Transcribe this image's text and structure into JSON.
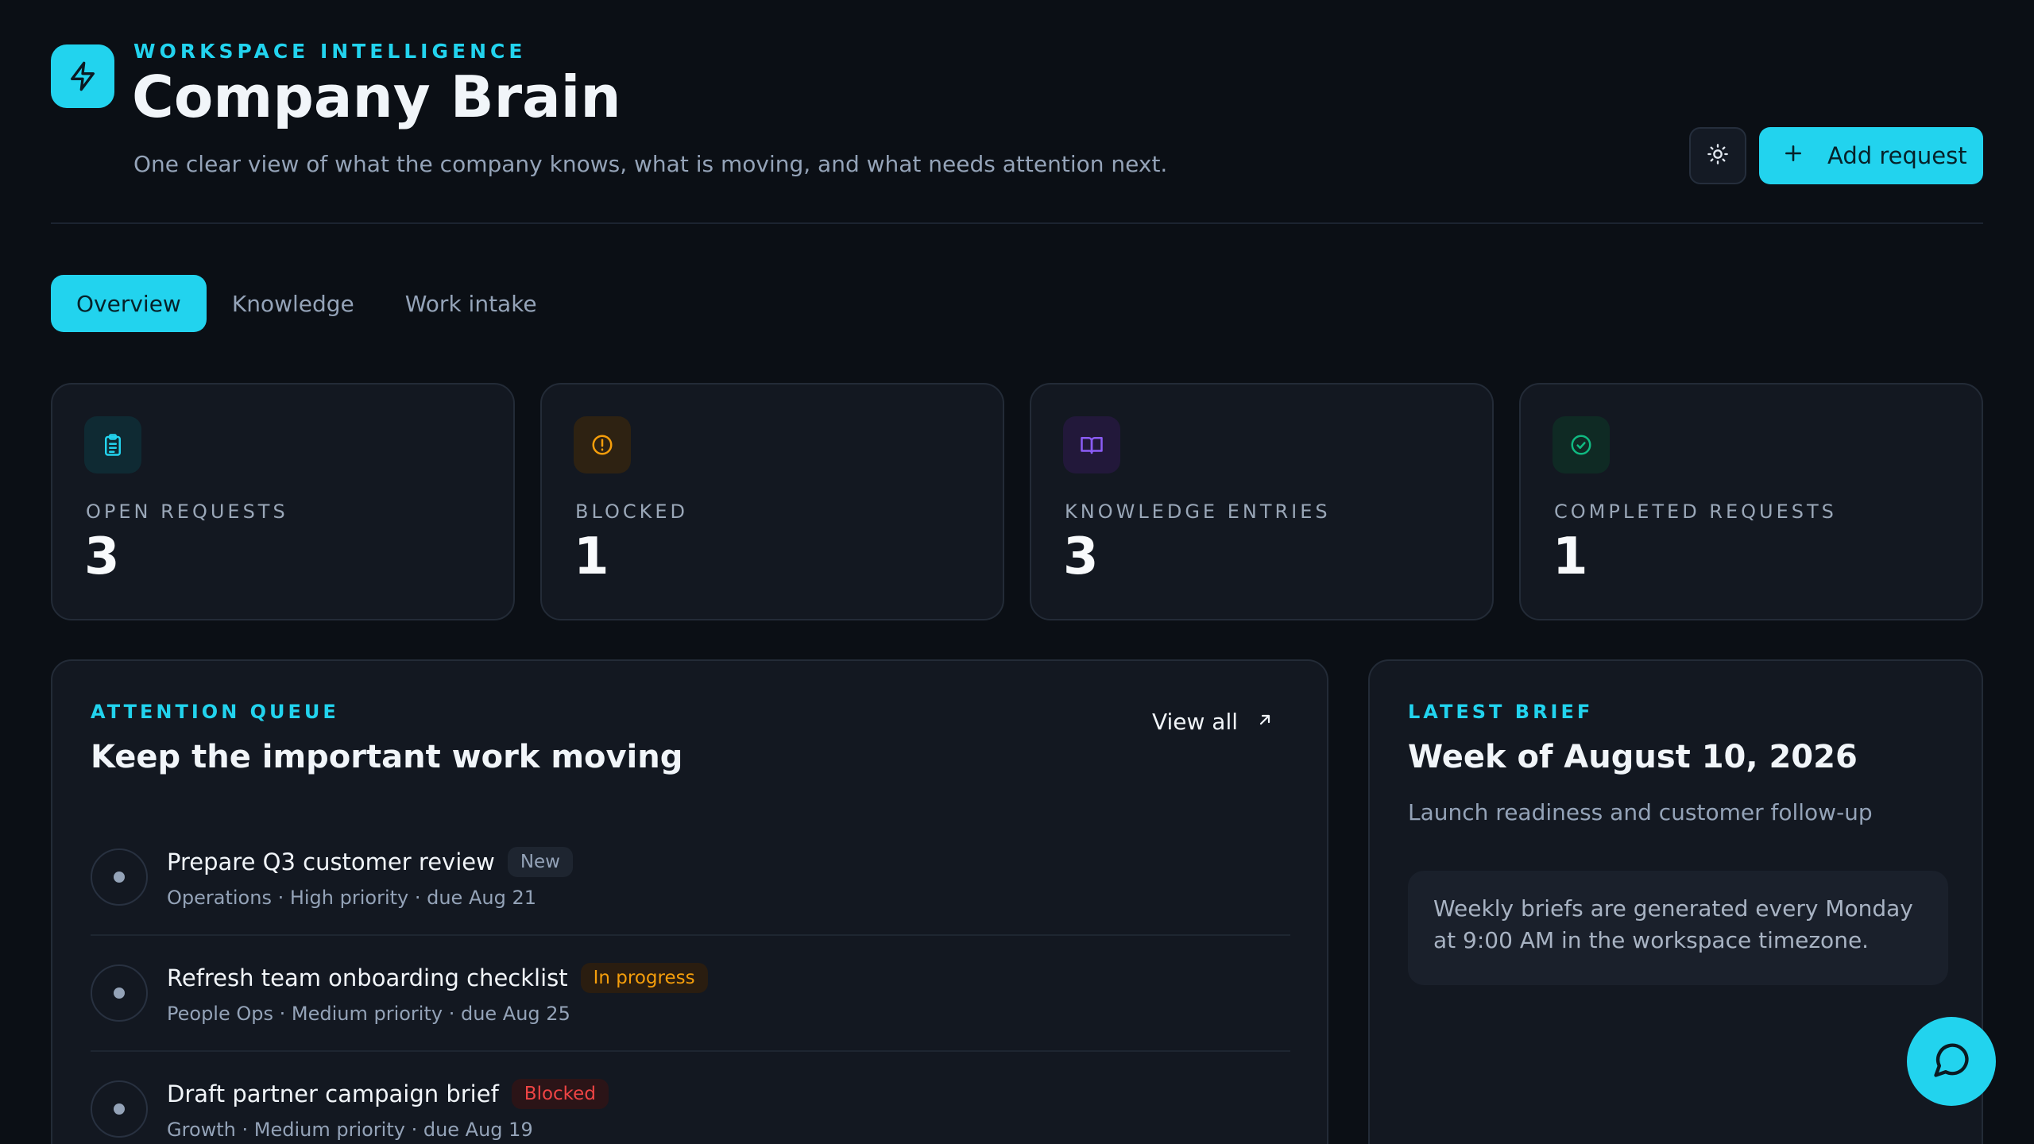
{
  "header": {
    "eyebrow": "WORKSPACE INTELLIGENCE",
    "title": "Company Brain",
    "subtitle": "One clear view of what the company knows, what is moving, and what needs attention next.",
    "logo_icon": "lightning-bolt-icon",
    "theme_toggle_icon": "sun-icon",
    "add_request_label": "Add request",
    "add_request_icon": "plus-icon"
  },
  "tabs": [
    {
      "label": "Overview",
      "active": true
    },
    {
      "label": "Knowledge",
      "active": false
    },
    {
      "label": "Work intake",
      "active": false
    }
  ],
  "stats": [
    {
      "label": "OPEN REQUESTS",
      "value": "3",
      "icon": "clipboard-icon",
      "color": "#22d3ee"
    },
    {
      "label": "BLOCKED",
      "value": "1",
      "icon": "alert-circle-icon",
      "color": "#f59e0b"
    },
    {
      "label": "KNOWLEDGE ENTRIES",
      "value": "3",
      "icon": "book-open-icon",
      "color": "#8b5cf6"
    },
    {
      "label": "COMPLETED REQUESTS",
      "value": "1",
      "icon": "check-circle-icon",
      "color": "#10b981"
    }
  ],
  "attention": {
    "eyebrow": "ATTENTION QUEUE",
    "title": "Keep the important work moving",
    "view_all": "View all",
    "items": [
      {
        "title": "Prepare Q3 customer review",
        "status": "New",
        "meta": "Operations · High priority · due Aug 21"
      },
      {
        "title": "Refresh team onboarding checklist",
        "status": "In progress",
        "meta": "People Ops · Medium priority · due Aug 25"
      },
      {
        "title": "Draft partner campaign brief",
        "status": "Blocked",
        "meta": "Growth · Medium priority · due Aug 19"
      }
    ]
  },
  "brief": {
    "eyebrow": "LATEST BRIEF",
    "title": "Week of August 10, 2026",
    "subtitle": "Launch readiness and customer follow-up",
    "note": "Weekly briefs are generated every Monday at 9:00 AM in the workspace timezone."
  },
  "chat": {
    "icon": "chat-bubble-icon"
  },
  "colors": {
    "accent": "#22d3ee",
    "background": "#0b0f15",
    "card": "#131821",
    "warning": "#f59e0b",
    "danger": "#ef4444",
    "knowledge": "#8b5cf6",
    "success": "#10b981"
  }
}
